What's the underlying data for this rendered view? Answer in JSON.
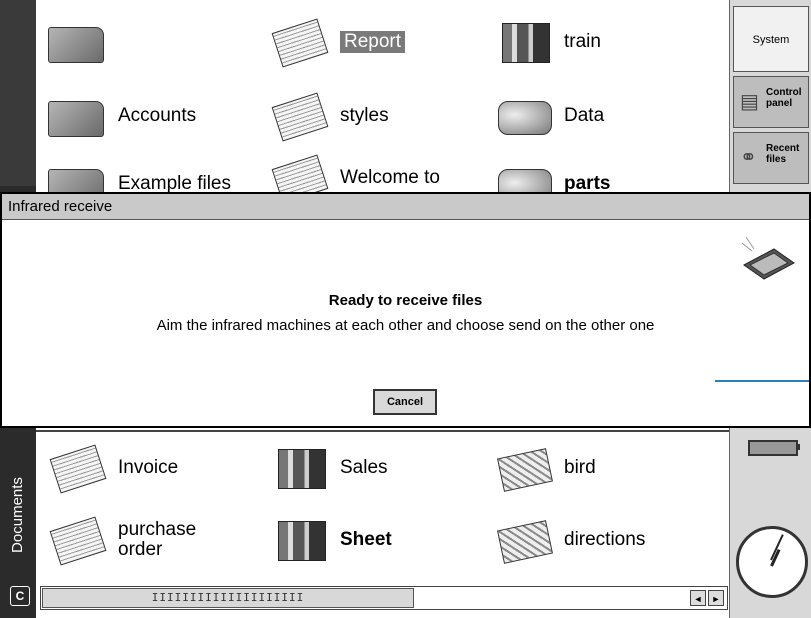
{
  "sidebar": {
    "system_label": "System",
    "control_label": "Control panel",
    "recent_label": "Recent files"
  },
  "left_bar": {
    "documents_label": "Documents",
    "c_label": "C"
  },
  "icons_top": [
    {
      "label": "",
      "type": "folder"
    },
    {
      "label": "Report",
      "type": "doc",
      "selected": true
    },
    {
      "label": "train",
      "type": "sheet"
    },
    {
      "label": "Accounts",
      "type": "folder"
    },
    {
      "label": "styles",
      "type": "doc"
    },
    {
      "label": "Data",
      "type": "data"
    },
    {
      "label": "Example files",
      "type": "folder"
    },
    {
      "label": "Welcome to",
      "type": "doc"
    },
    {
      "label": "parts",
      "type": "data"
    }
  ],
  "icons_bottom": [
    {
      "label": "Invoice",
      "type": "doc"
    },
    {
      "label": "Sales",
      "type": "sheet"
    },
    {
      "label": "bird",
      "type": "sketch"
    },
    {
      "label": "purchase order",
      "type": "doc"
    },
    {
      "label": "Sheet",
      "type": "sheet"
    },
    {
      "label": "directions",
      "type": "sketch"
    }
  ],
  "dialog": {
    "title": "Infrared receive",
    "heading": "Ready to receive files",
    "message": "Aim the infrared machines at each other and choose send on the other one",
    "cancel_label": "Cancel"
  },
  "scrollbar": {
    "thumb_text": "IIIIIIIIIIIIIIIIIIII",
    "left_arrow": "◄",
    "right_arrow": "►"
  },
  "colors": {
    "accent_line": "#2a7fbf",
    "selection_bg": "#7a7a7a"
  }
}
